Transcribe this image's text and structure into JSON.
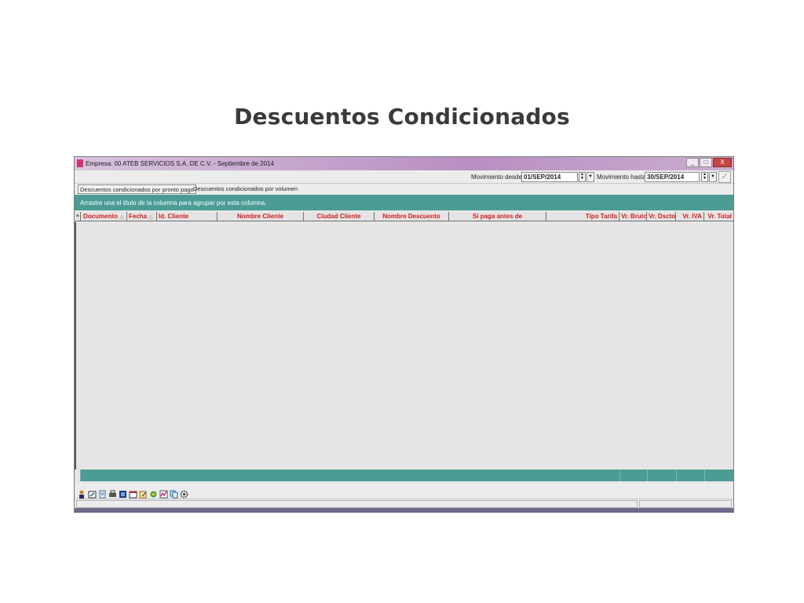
{
  "slide": {
    "title": "Descuentos Condicionados"
  },
  "window": {
    "title": "Empresa: 00 ATEB SERVICIOS S.A. DE C.V. - Septiembre de 2014",
    "buttons": {
      "minimize": "_",
      "maximize": "□",
      "close": "X"
    }
  },
  "filters": {
    "desde_label": "Movimiento desde:",
    "desde_value": "01/SEP/2014",
    "hasta_label": "Movimiento hasta:",
    "hasta_value": "30/SEP/2014",
    "apply_icon": "check-icon"
  },
  "tabs": [
    {
      "label": "Descuentos condicionados por pronto pago",
      "active": true
    },
    {
      "label": "Descuentos condicionados por volumen",
      "active": false
    }
  ],
  "group_panel": {
    "hint": "Arrastre una el titulo de la columna para agrupar por esta columna."
  },
  "grid": {
    "columns": [
      {
        "label": "Documento",
        "sort": "△"
      },
      {
        "label": "Fecha",
        "sort": "△"
      },
      {
        "label": "Id. Cliente",
        "sort": ""
      },
      {
        "label": "Nombre Cliente",
        "sort": ""
      },
      {
        "label": "Ciudad Cliente",
        "sort": ""
      },
      {
        "label": "Nombre Descuento",
        "sort": ""
      },
      {
        "label": "Si paga antes de",
        "sort": ""
      },
      {
        "label": "Tipo Tarifa",
        "sort": ""
      },
      {
        "label": "Vr. Bruto",
        "sort": ""
      },
      {
        "label": "Vr. Dscto",
        "sort": ""
      },
      {
        "label": "Vr. IVA",
        "sort": ""
      },
      {
        "label": "Vr. Total",
        "sort": ""
      }
    ],
    "rows": []
  },
  "toolbar_icons": [
    "user-icon",
    "export-icon",
    "document-icon",
    "print-icon",
    "report-icon",
    "calendar-icon",
    "edit-icon",
    "refresh-icon",
    "chart-icon",
    "copy-icon",
    "settings-icon"
  ],
  "colors": {
    "accent": "#4a9c94",
    "header_text": "#d41c1c",
    "titlebar": "#c7a8cf"
  }
}
